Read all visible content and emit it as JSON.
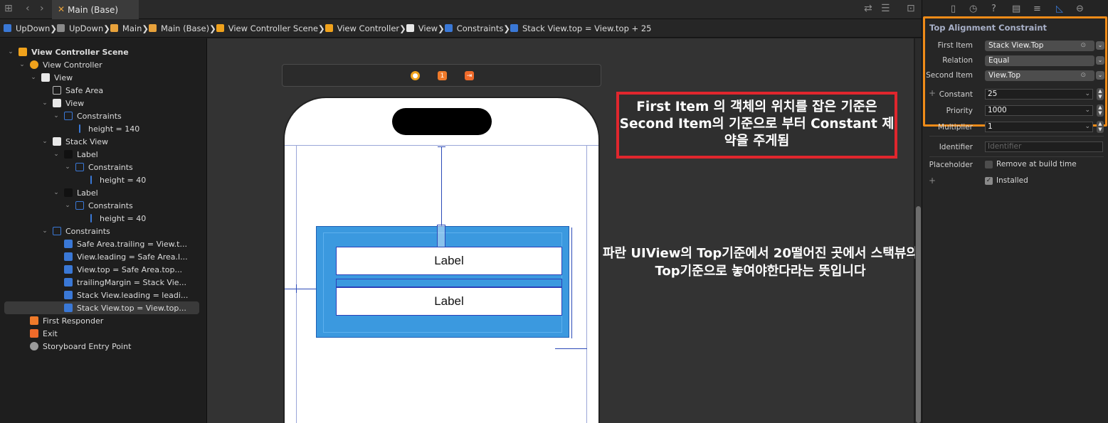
{
  "tabbar": {
    "active_tab": "Main (Base)"
  },
  "breadcrumb": [
    {
      "label": "UpDown",
      "icon": "app-icon",
      "color": "#3a78d6"
    },
    {
      "label": "UpDown",
      "icon": "folder-icon",
      "color": "#8a8a8a"
    },
    {
      "label": "Main",
      "icon": "storyboard-icon",
      "color": "#e8a23b"
    },
    {
      "label": "Main (Base)",
      "icon": "storyboard-icon",
      "color": "#e8a23b"
    },
    {
      "label": "View Controller Scene",
      "icon": "scene-icon",
      "color": "#f0a21c"
    },
    {
      "label": "View Controller",
      "icon": "view-controller-icon",
      "color": "#f0a21c"
    },
    {
      "label": "View",
      "icon": "view-icon",
      "color": "#e8e8e8"
    },
    {
      "label": "Constraints",
      "icon": "constraints-icon",
      "color": "#3a78d6"
    },
    {
      "label": "Stack View.top = View.top + 25",
      "icon": "constraint-icon",
      "color": "#3a78d6"
    }
  ],
  "navigator": {
    "items": [
      {
        "label": "View Controller Scene",
        "depth": 0,
        "chevron": "down",
        "icon": "scene-icon",
        "bold": true
      },
      {
        "label": "View Controller",
        "depth": 1,
        "chevron": "down",
        "icon": "view-controller-icon"
      },
      {
        "label": "View",
        "depth": 2,
        "chevron": "down",
        "icon": "view-icon"
      },
      {
        "label": "Safe Area",
        "depth": 3,
        "chevron": "",
        "icon": "safe-area-icon"
      },
      {
        "label": "View",
        "depth": 3,
        "chevron": "down",
        "icon": "view-icon"
      },
      {
        "label": "Constraints",
        "depth": 4,
        "chevron": "down",
        "icon": "constraints-icon"
      },
      {
        "label": "height = 140",
        "depth": 5,
        "chevron": "",
        "icon": "height-constraint-icon"
      },
      {
        "label": "Stack View",
        "depth": 3,
        "chevron": "down",
        "icon": "stack-view-icon"
      },
      {
        "label": "Label",
        "depth": 4,
        "chevron": "down",
        "icon": "label-icon"
      },
      {
        "label": "Constraints",
        "depth": 5,
        "chevron": "down",
        "icon": "constraints-icon"
      },
      {
        "label": "height = 40",
        "depth": 6,
        "chevron": "",
        "icon": "height-constraint-icon"
      },
      {
        "label": "Label",
        "depth": 4,
        "chevron": "down",
        "icon": "label-icon"
      },
      {
        "label": "Constraints",
        "depth": 5,
        "chevron": "down",
        "icon": "constraints-icon"
      },
      {
        "label": "height = 40",
        "depth": 6,
        "chevron": "",
        "icon": "height-constraint-icon"
      },
      {
        "label": "Constraints",
        "depth": 3,
        "chevron": "down",
        "icon": "constraints-icon"
      },
      {
        "label": "Safe Area.trailing = View.t...",
        "depth": 4,
        "chevron": "",
        "icon": "trailing-constraint-icon"
      },
      {
        "label": "View.leading = Safe Area.l...",
        "depth": 4,
        "chevron": "",
        "icon": "leading-constraint-icon"
      },
      {
        "label": "View.top = Safe Area.top...",
        "depth": 4,
        "chevron": "",
        "icon": "top-constraint-icon"
      },
      {
        "label": "trailingMargin = Stack Vie...",
        "depth": 4,
        "chevron": "",
        "icon": "trailing-constraint-icon"
      },
      {
        "label": "Stack View.leading = leadi...",
        "depth": 4,
        "chevron": "",
        "icon": "leading-constraint-icon"
      },
      {
        "label": "Stack View.top = View.top...",
        "depth": 4,
        "chevron": "",
        "icon": "top-constraint-icon",
        "selected": true
      },
      {
        "label": "First Responder",
        "depth": 1,
        "chevron": "",
        "icon": "first-responder-icon"
      },
      {
        "label": "Exit",
        "depth": 1,
        "chevron": "",
        "icon": "exit-icon"
      },
      {
        "label": "Storyboard Entry Point",
        "depth": 1,
        "chevron": "",
        "icon": "entry-point-icon"
      }
    ]
  },
  "canvas": {
    "label_top": "Label",
    "label_bottom": "Label",
    "annotation_box": "First Item 의 객체의 위치를 잡은 기준은 Second Item의 기준으로 부터 Constant 제약을 주게됨",
    "annotation_text": "파란 UIView의 Top기준에서 20떨어진 곳에서 스택뷰의 Top기준으로 놓여야한다라는 뜻입니다"
  },
  "inspector": {
    "section_title": "Top Alignment Constraint",
    "first_item_label": "First Item",
    "first_item_value": "Stack View.Top",
    "relation_label": "Relation",
    "relation_value": "Equal",
    "second_item_label": "Second Item",
    "second_item_value": "View.Top",
    "constant_label": "Constant",
    "constant_value": "25",
    "priority_label": "Priority",
    "priority_value": "1000",
    "multiplier_label": "Multiplier",
    "multiplier_value": "1",
    "identifier_label": "Identifier",
    "identifier_placeholder": "Identifier",
    "placeholder_label": "Placeholder",
    "remove_at_build_label": "Remove at build time",
    "installed_label": "Installed",
    "highlight_color": "#f08b18"
  },
  "colors": {
    "accent": "#3a78d6",
    "annotation_border": "#e0262d",
    "stack_fill": "#3b99df"
  }
}
